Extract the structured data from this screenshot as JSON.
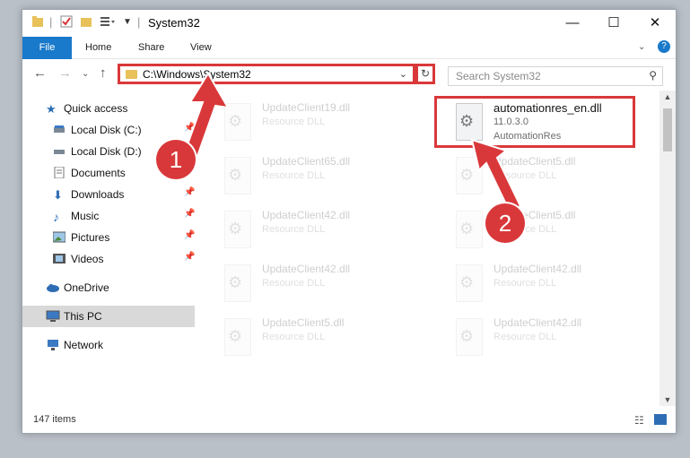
{
  "window": {
    "title": "System32",
    "controls": {
      "minimize": "—",
      "maximize": "☐",
      "close": "✕"
    }
  },
  "ribbon": {
    "tabs": [
      "File",
      "Home",
      "Share",
      "View"
    ],
    "help": "?"
  },
  "address": {
    "path": "C:\\Windows\\System32",
    "search_placeholder": "Search System32"
  },
  "sidebar": {
    "items": [
      {
        "label": "Quick access",
        "icon": "star-icon"
      },
      {
        "label": "Local Disk (C:)",
        "icon": "drive-icon"
      },
      {
        "label": "Local Disk (D:)",
        "icon": "drive-icon"
      },
      {
        "label": "Documents",
        "icon": "documents-icon"
      },
      {
        "label": "Downloads",
        "icon": "download-icon"
      },
      {
        "label": "Music",
        "icon": "music-icon"
      },
      {
        "label": "Pictures",
        "icon": "pictures-icon"
      },
      {
        "label": "Videos",
        "icon": "videos-icon"
      },
      {
        "label": "OneDrive",
        "icon": "cloud-icon"
      },
      {
        "label": "This PC",
        "icon": "computer-icon"
      },
      {
        "label": "Network",
        "icon": "network-icon"
      }
    ]
  },
  "files": {
    "left": [
      {
        "name": "UpdateClient19.dll",
        "type": "Resource DLL"
      },
      {
        "name": "UpdateClient65.dll",
        "type": "Resource DLL"
      },
      {
        "name": "UpdateClient42.dll",
        "type": "Resource DLL"
      },
      {
        "name": "UpdateClient42.dll",
        "type": "Resource DLL"
      },
      {
        "name": "UpdateClient5.dll",
        "type": "Resource DLL"
      }
    ],
    "right": [
      {
        "name": "automationres_en.dll",
        "version": "11.0.3.0",
        "type": "AutomationRes"
      },
      {
        "name": "UpdateClient5.dll",
        "type": "Resource DLL"
      },
      {
        "name": "UpdateClient5.dll",
        "type": "Resource DLL"
      },
      {
        "name": "UpdateClient42.dll",
        "type": "Resource DLL"
      },
      {
        "name": "UpdateClient42.dll",
        "type": "Resource DLL"
      }
    ]
  },
  "status": {
    "count": "147 items"
  },
  "callouts": [
    "1",
    "2"
  ],
  "colors": {
    "accent": "#1979ca",
    "highlight": "#d9383a"
  }
}
